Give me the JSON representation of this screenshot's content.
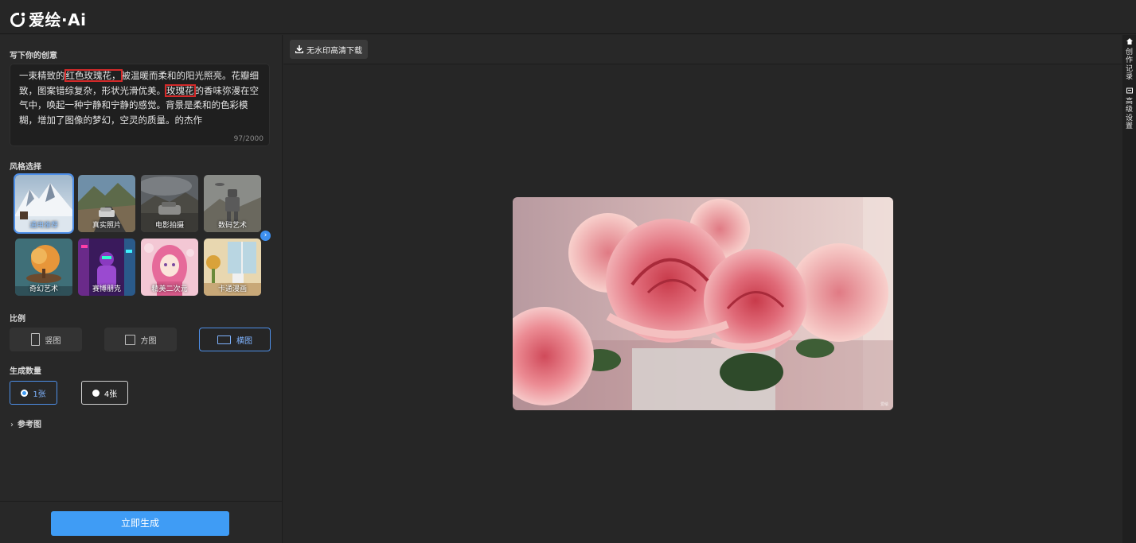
{
  "app": {
    "logo_text": "爱绘·Ai"
  },
  "prompt": {
    "label": "写下你的创意",
    "segments": [
      {
        "text": "一束精致的",
        "hl": false
      },
      {
        "text": "红色玫瑰花，",
        "hl": true
      },
      {
        "text": "被温暖而柔和的阳光照亮。花瓣细致，图案错综复杂，形状光滑优美。",
        "hl": false
      },
      {
        "text": "玫瑰花",
        "hl": true
      },
      {
        "text": "的香味弥漫在空气中，唤起一种宁静和宁静的感觉。背景是柔和的色彩模糊，增加了图像的梦幻，空灵的质量。的杰作",
        "hl": false
      }
    ],
    "count": "97/2000"
  },
  "styles": {
    "label": "风格选择",
    "items": [
      {
        "label": "通用推荐",
        "selected": true,
        "icon": "snowy-mountain-thumbnail"
      },
      {
        "label": "真实照片",
        "selected": false,
        "icon": "car-road-thumbnail"
      },
      {
        "label": "电影拍摄",
        "selected": false,
        "icon": "car-storm-thumbnail"
      },
      {
        "label": "数码艺术",
        "selected": false,
        "icon": "robot-thumbnail"
      },
      {
        "label": "奇幻艺术",
        "selected": false,
        "icon": "floating-tree-thumbnail"
      },
      {
        "label": "赛博朋克",
        "selected": false,
        "icon": "cyberpunk-figure-thumbnail"
      },
      {
        "label": "精美二次元",
        "selected": false,
        "icon": "anime-girl-thumbnail"
      },
      {
        "label": "卡通漫画",
        "selected": false,
        "icon": "cartoon-room-thumbnail"
      }
    ],
    "next_icon": "chevron-right-icon"
  },
  "ratio": {
    "label": "比例",
    "options": [
      {
        "label": "竖图",
        "selected": false
      },
      {
        "label": "方图",
        "selected": false
      },
      {
        "label": "横图",
        "selected": true
      }
    ]
  },
  "quantity": {
    "label": "生成数量",
    "options": [
      {
        "label": "1张",
        "selected": true
      },
      {
        "label": "4张",
        "selected": false
      }
    ]
  },
  "reference": {
    "label": "参考图"
  },
  "generate": {
    "label": "立即生成"
  },
  "toolbar": {
    "download_label": "无水印高清下载"
  },
  "result": {
    "subject": "pink-roses-image",
    "watermark": "爱绘"
  },
  "side_tabs": [
    {
      "label": "创作记录",
      "icon": "home-icon"
    },
    {
      "label": "高级设置",
      "icon": "settings-icon"
    }
  ],
  "colors": {
    "accent": "#3f9cf5",
    "highlight_box": "#d42a2a",
    "background": "#262626",
    "panel": "#282828"
  }
}
